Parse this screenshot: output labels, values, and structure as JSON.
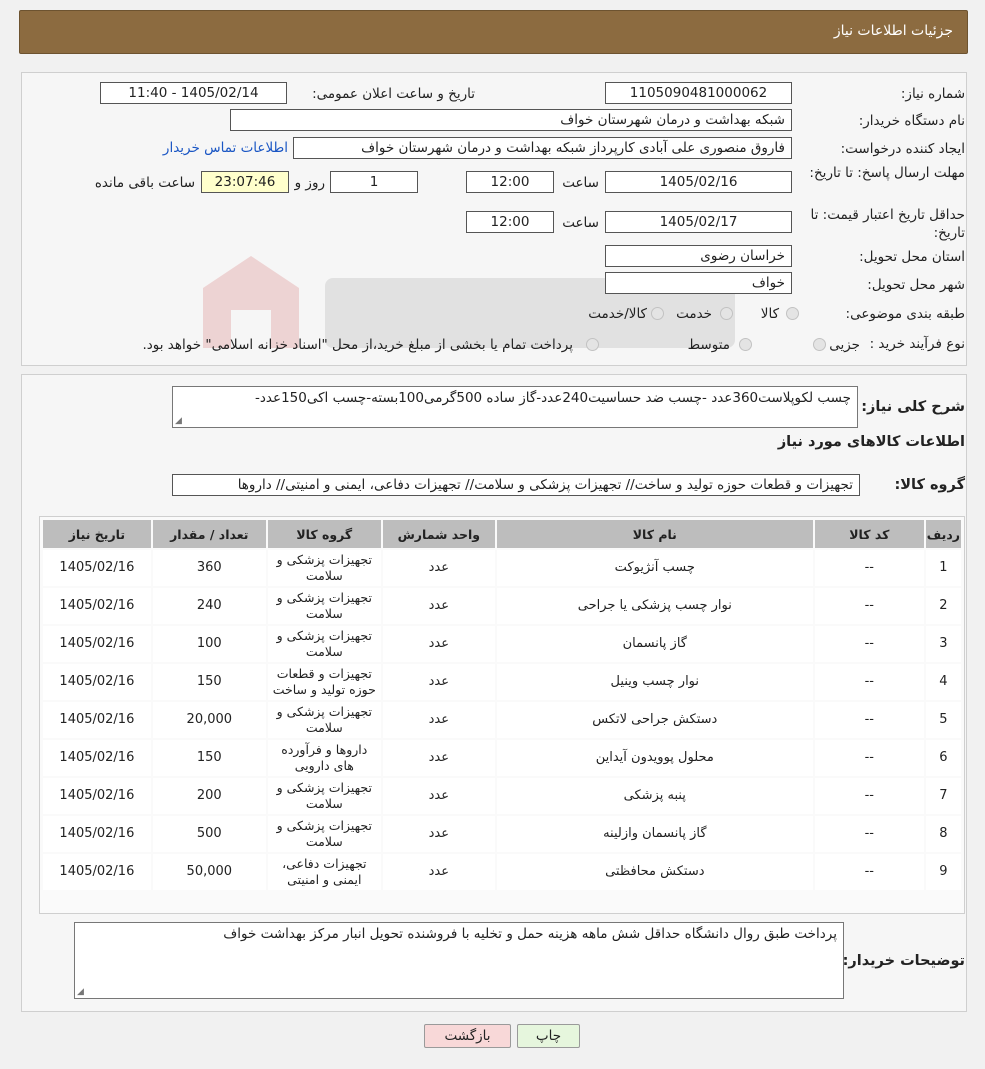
{
  "header": {
    "title": "جزئیات اطلاعات نیاز"
  },
  "form": {
    "need_number": {
      "label": "شماره نیاز:",
      "value": "1105090481000062"
    },
    "announce": {
      "label": "تاریخ و ساعت اعلان عمومی:",
      "value": "1405/02/14 - 11:40"
    },
    "buyer_org": {
      "label": "نام دستگاه خریدار:",
      "value": "شبکه بهداشت و درمان شهرستان خواف"
    },
    "creator": {
      "label": "ایجاد کننده درخواست:",
      "value": "فاروق منصوری علی آبادی کارپرداز شبکه بهداشت و درمان شهرستان خواف",
      "link": "اطلاعات تماس خریدار"
    },
    "reply_deadline": {
      "label": "مهلت ارسال پاسخ: تا تاریخ:",
      "date": "1405/02/16",
      "time_label": "ساعت",
      "time": "12:00",
      "days": "1",
      "days_label": "روز و",
      "remaining": "23:07:46",
      "remaining_label": "ساعت باقی مانده"
    },
    "price_validity": {
      "label": "حداقل تاریخ اعتبار قیمت: تا تاریخ:",
      "date": "1405/02/17",
      "time_label": "ساعت",
      "time": "12:00"
    },
    "province": {
      "label": "استان محل تحویل:",
      "value": "خراسان رضوی"
    },
    "city": {
      "label": "شهر محل تحویل:",
      "value": "خواف"
    },
    "category": {
      "label": "طبقه بندی موضوعی:",
      "options": [
        "کالا",
        "خدمت",
        "کالا/خدمت"
      ]
    },
    "process": {
      "label": "نوع فرآیند خرید :",
      "options": [
        "جزیی",
        "متوسط"
      ],
      "note": "پرداخت تمام یا بخشی از مبلغ خرید،از محل \"اسناد خزانه اسلامی\" خواهد بود."
    }
  },
  "details": {
    "summary_label": "شرح کلی نیاز:",
    "summary": "چسب لکوپلاست360عدد -چسب ضد حساسیت240عدد-گاز ساده 500گرمی100بسته-چسب اکی150عدد-",
    "goods_title": "اطلاعات کالاهای مورد نیاز",
    "group_label": "گروه کالا:",
    "group": "تجهیزات و قطعات حوزه تولید و ساخت// تجهیزات پزشکی و سلامت// تجهیزات دفاعی، ایمنی و امنیتی// داروها"
  },
  "table": {
    "headers": [
      "ردیف",
      "کد کالا",
      "نام کالا",
      "واحد شمارش",
      "گروه کالا",
      "تعداد / مقدار",
      "تاریخ نیاز"
    ],
    "rows": [
      {
        "no": "1",
        "code": "--",
        "name": "چسب آنژیوکت",
        "unit": "عدد",
        "group": "تجهیزات پزشکی و سلامت",
        "qty": "360",
        "date": "1405/02/16"
      },
      {
        "no": "2",
        "code": "--",
        "name": "نوار چسب پزشکی یا جراحی",
        "unit": "عدد",
        "group": "تجهیزات پزشکی و سلامت",
        "qty": "240",
        "date": "1405/02/16"
      },
      {
        "no": "3",
        "code": "--",
        "name": "گاز پانسمان",
        "unit": "عدد",
        "group": "تجهیزات پزشکی و سلامت",
        "qty": "100",
        "date": "1405/02/16"
      },
      {
        "no": "4",
        "code": "--",
        "name": "نوار چسب وینیل",
        "unit": "عدد",
        "group": "تجهیزات و قطعات حوزه تولید و ساخت",
        "qty": "150",
        "date": "1405/02/16"
      },
      {
        "no": "5",
        "code": "--",
        "name": "دستکش جراحی لاتکس",
        "unit": "عدد",
        "group": "تجهیزات پزشکی و سلامت",
        "qty": "20,000",
        "date": "1405/02/16"
      },
      {
        "no": "6",
        "code": "--",
        "name": "محلول پوویدون آیداین",
        "unit": "عدد",
        "group": "داروها و فرآورده های دارویی",
        "qty": "150",
        "date": "1405/02/16"
      },
      {
        "no": "7",
        "code": "--",
        "name": "پنبه پزشکی",
        "unit": "عدد",
        "group": "تجهیزات پزشکی و سلامت",
        "qty": "200",
        "date": "1405/02/16"
      },
      {
        "no": "8",
        "code": "--",
        "name": "گاز پانسمان وازلینه",
        "unit": "عدد",
        "group": "تجهیزات پزشکی و سلامت",
        "qty": "500",
        "date": "1405/02/16"
      },
      {
        "no": "9",
        "code": "--",
        "name": "دستکش محافظتی",
        "unit": "عدد",
        "group": "تجهیزات دفاعی، ایمنی و امنیتی",
        "qty": "50,000",
        "date": "1405/02/16"
      }
    ]
  },
  "buyer_notes": {
    "label": "توضیحات خریدار:",
    "text": "پرداخت طبق روال دانشگاه حداقل شش ماهه  هزینه حمل و تخلیه با فروشنده تحویل انبار مرکز بهداشت خواف"
  },
  "buttons": {
    "print": "چاپ",
    "back": "بازگشت"
  },
  "colors": {
    "header_bg": "#8c6b40",
    "print_bg": "#e6f6dd",
    "back_bg": "#f8d8d8",
    "link": "#1a56c4"
  }
}
